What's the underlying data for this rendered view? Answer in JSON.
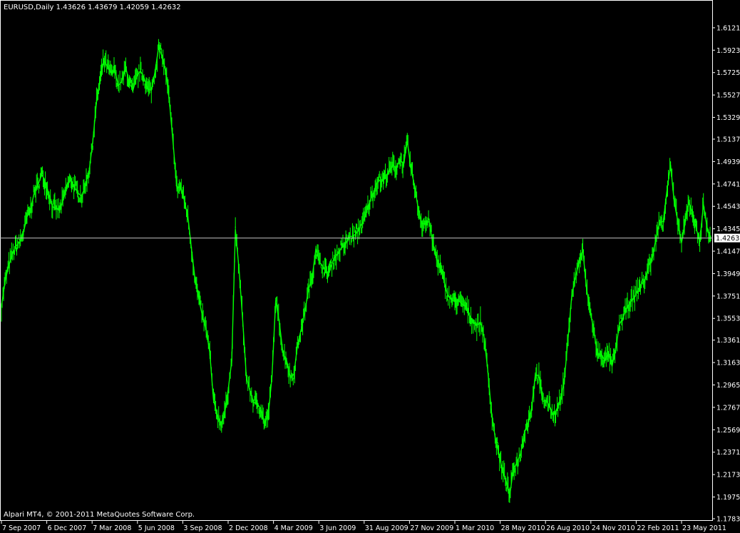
{
  "window": {
    "header": "EURUSD,Daily  1.43626 1.43679 1.42059 1.42632",
    "copyright": "Alpari MT4, © 2001-2011 MetaQuotes Software Corp."
  },
  "colors": {
    "background": "#000000",
    "candles": "#00ff00",
    "frame": "#ffffff",
    "text": "#ffffff",
    "bid_line": "#c0c0c0",
    "bid_label_bg": "#ffffff",
    "bid_label_text": "#000000"
  },
  "chart_data": {
    "type": "line",
    "symbol": "EURUSD",
    "timeframe": "Daily",
    "bar_style": "OHLC bars",
    "grid": false,
    "ylim": [
      1.1783,
      1.6215
    ],
    "y_ticks": [
      "1.61210",
      "1.59230",
      "1.57250",
      "1.55270",
      "1.53290",
      "1.51370",
      "1.49390",
      "1.47410",
      "1.45430",
      "1.43450",
      "1.41470",
      "1.39490",
      "1.37510",
      "1.35530",
      "1.33610",
      "1.31630",
      "1.29650",
      "1.27670",
      "1.25690",
      "1.23710",
      "1.21730",
      "1.19750",
      "1.17830"
    ],
    "x_ticks": [
      "7 Sep 2007",
      "6 Dec 2007",
      "7 Mar 2008",
      "5 Jun 2008",
      "3 Sep 2008",
      "2 Dec 2008",
      "4 Mar 2009",
      "3 Jun 2009",
      "31 Aug 2009",
      "27 Nov 2009",
      "1 Mar 2010",
      "28 May 2010",
      "26 Aug 2010",
      "24 Nov 2010",
      "22 Feb 2011",
      "23 May 2011"
    ],
    "last_price": 1.42632,
    "last_price_label": "1.42632",
    "series": [
      {
        "values": [
          1.366,
          1.388,
          1.402,
          1.412,
          1.419,
          1.423,
          1.431,
          1.445,
          1.452,
          1.467,
          1.473,
          1.483,
          1.476,
          1.465,
          1.454,
          1.452,
          1.451,
          1.462,
          1.473,
          1.478,
          1.471,
          1.466,
          1.463,
          1.474,
          1.486,
          1.512,
          1.547,
          1.566,
          1.583,
          1.578,
          1.572,
          1.575,
          1.561,
          1.565,
          1.577,
          1.563,
          1.557,
          1.569,
          1.574,
          1.568,
          1.558,
          1.557,
          1.573,
          1.595,
          1.586,
          1.572,
          1.545,
          1.508,
          1.47,
          1.472,
          1.46,
          1.445,
          1.416,
          1.389,
          1.372,
          1.357,
          1.345,
          1.325,
          1.283,
          1.271,
          1.262,
          1.27,
          1.292,
          1.318,
          1.434,
          1.398,
          1.353,
          1.303,
          1.291,
          1.281,
          1.28,
          1.275,
          1.262,
          1.27,
          1.304,
          1.371,
          1.352,
          1.325,
          1.318,
          1.303,
          1.306,
          1.332,
          1.346,
          1.362,
          1.381,
          1.392,
          1.417,
          1.405,
          1.401,
          1.395,
          1.4,
          1.409,
          1.412,
          1.418,
          1.42,
          1.427,
          1.428,
          1.43,
          1.436,
          1.441,
          1.451,
          1.461,
          1.468,
          1.478,
          1.476,
          1.481,
          1.485,
          1.491,
          1.488,
          1.496,
          1.491,
          1.512,
          1.488,
          1.472,
          1.452,
          1.439,
          1.439,
          1.441,
          1.421,
          1.409,
          1.4,
          1.389,
          1.376,
          1.372,
          1.37,
          1.371,
          1.368,
          1.366,
          1.358,
          1.352,
          1.349,
          1.352,
          1.339,
          1.31,
          1.273,
          1.251,
          1.236,
          1.221,
          1.212,
          1.198,
          1.222,
          1.228,
          1.236,
          1.254,
          1.264,
          1.276,
          1.305,
          1.305,
          1.282,
          1.283,
          1.277,
          1.27,
          1.276,
          1.284,
          1.302,
          1.339,
          1.376,
          1.392,
          1.405,
          1.416,
          1.382,
          1.362,
          1.345,
          1.323,
          1.324,
          1.318,
          1.324,
          1.313,
          1.327,
          1.35,
          1.356,
          1.364,
          1.37,
          1.373,
          1.38,
          1.386,
          1.389,
          1.402,
          1.408,
          1.426,
          1.44,
          1.441,
          1.468,
          1.491,
          1.458,
          1.441,
          1.422,
          1.44,
          1.458,
          1.449,
          1.435,
          1.423,
          1.456,
          1.435,
          1.426
        ]
      }
    ]
  }
}
